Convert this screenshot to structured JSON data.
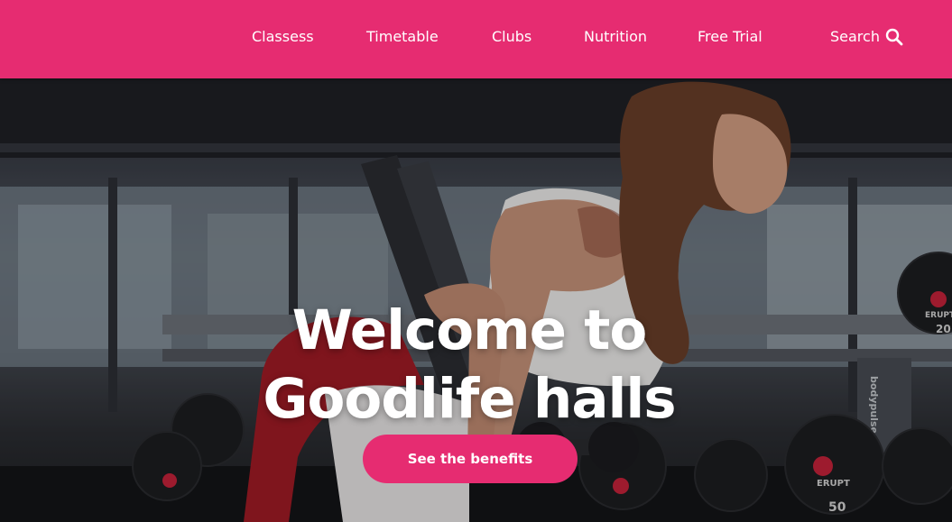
{
  "nav": {
    "items": [
      {
        "label": "Classess"
      },
      {
        "label": "Timetable"
      },
      {
        "label": "Clubs"
      },
      {
        "label": "Nutrition"
      },
      {
        "label": "Free Trial"
      }
    ],
    "search_label": "Search"
  },
  "hero": {
    "title_line1": "Welcome to",
    "title_line2": "Goodlife halls",
    "cta_label": "See the benefits",
    "weights": [
      {
        "brand": "ERUPT",
        "number": "50"
      },
      {
        "brand": "ERUPT",
        "number": "20"
      }
    ],
    "bench_text": "bodypulse"
  },
  "colors": {
    "brand": "#e62c71",
    "text": "#ffffff"
  },
  "icons": {
    "search": "search-icon"
  }
}
